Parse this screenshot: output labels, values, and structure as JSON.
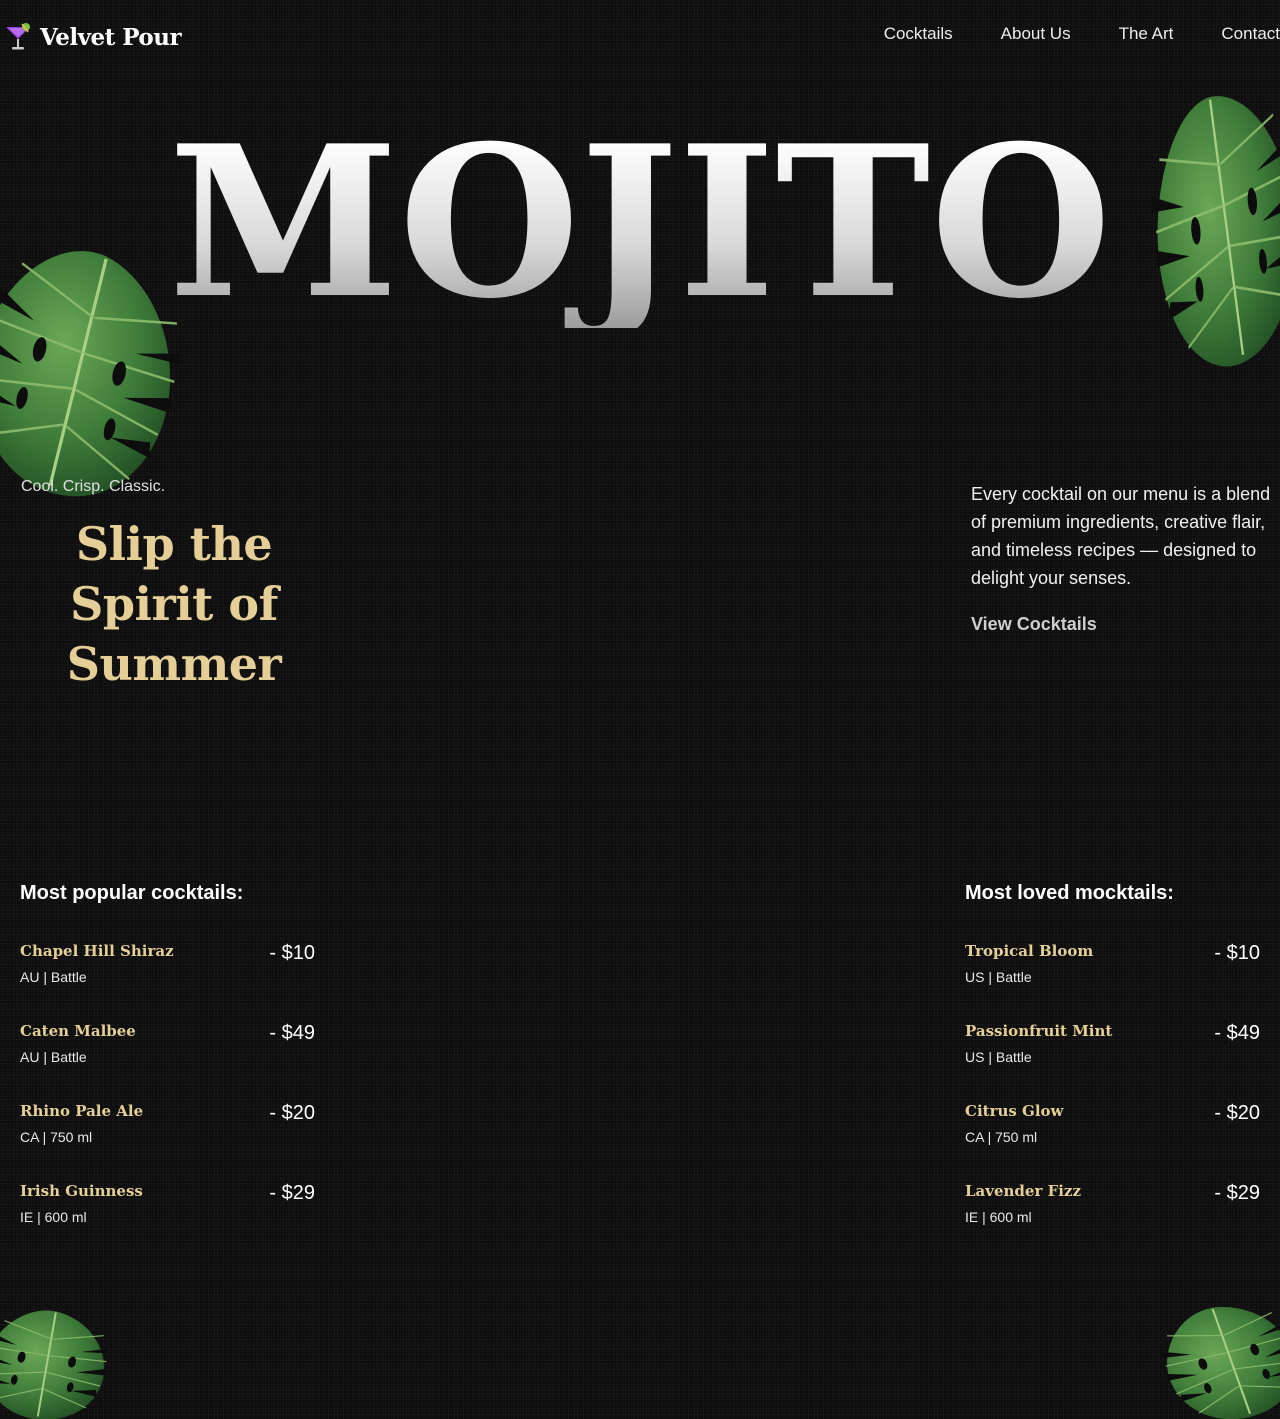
{
  "brand": {
    "name": "Velvet Pour",
    "icon": "cocktail-glass-icon"
  },
  "nav": {
    "links": [
      "Cocktails",
      "About Us",
      "The Art",
      "Contact"
    ]
  },
  "hero": {
    "title": "MOJITO",
    "tagline_small": "Cool. Crisp. Classic.",
    "tagline_big": "Slip the Spirit of Summer",
    "description": "Every cocktail on our menu is a blend of premium ingredients, creative flair, and timeless recipes — designed to delight your senses.",
    "cta_label": "View Cocktails"
  },
  "menus": {
    "cocktails": {
      "heading": "Most popular cocktails:",
      "items": [
        {
          "name": "Chapel Hill Shiraz",
          "meta": "AU | Battle",
          "price": "- $10"
        },
        {
          "name": "Caten Malbee",
          "meta": "AU | Battle",
          "price": "- $49"
        },
        {
          "name": "Rhino Pale Ale",
          "meta": "CA | 750 ml",
          "price": "- $20"
        },
        {
          "name": "Irish Guinness",
          "meta": "IE | 600 ml",
          "price": "- $29"
        }
      ]
    },
    "mocktails": {
      "heading": "Most loved mocktails:",
      "items": [
        {
          "name": "Tropical Bloom",
          "meta": "US | Battle",
          "price": "- $10"
        },
        {
          "name": "Passionfruit Mint",
          "meta": "US | Battle",
          "price": "- $49"
        },
        {
          "name": "Citrus Glow",
          "meta": "CA | 750 ml",
          "price": "- $20"
        },
        {
          "name": "Lavender Fizz",
          "meta": "IE | 600 ml",
          "price": "- $29"
        }
      ]
    }
  },
  "decor": {
    "leaf_icon": "monstera-leaf-icon"
  },
  "colors": {
    "background": "#0d0d0d",
    "accent_gold": "#e6cf97",
    "leaf_green": "#3f7d3a",
    "text": "#ffffff"
  }
}
